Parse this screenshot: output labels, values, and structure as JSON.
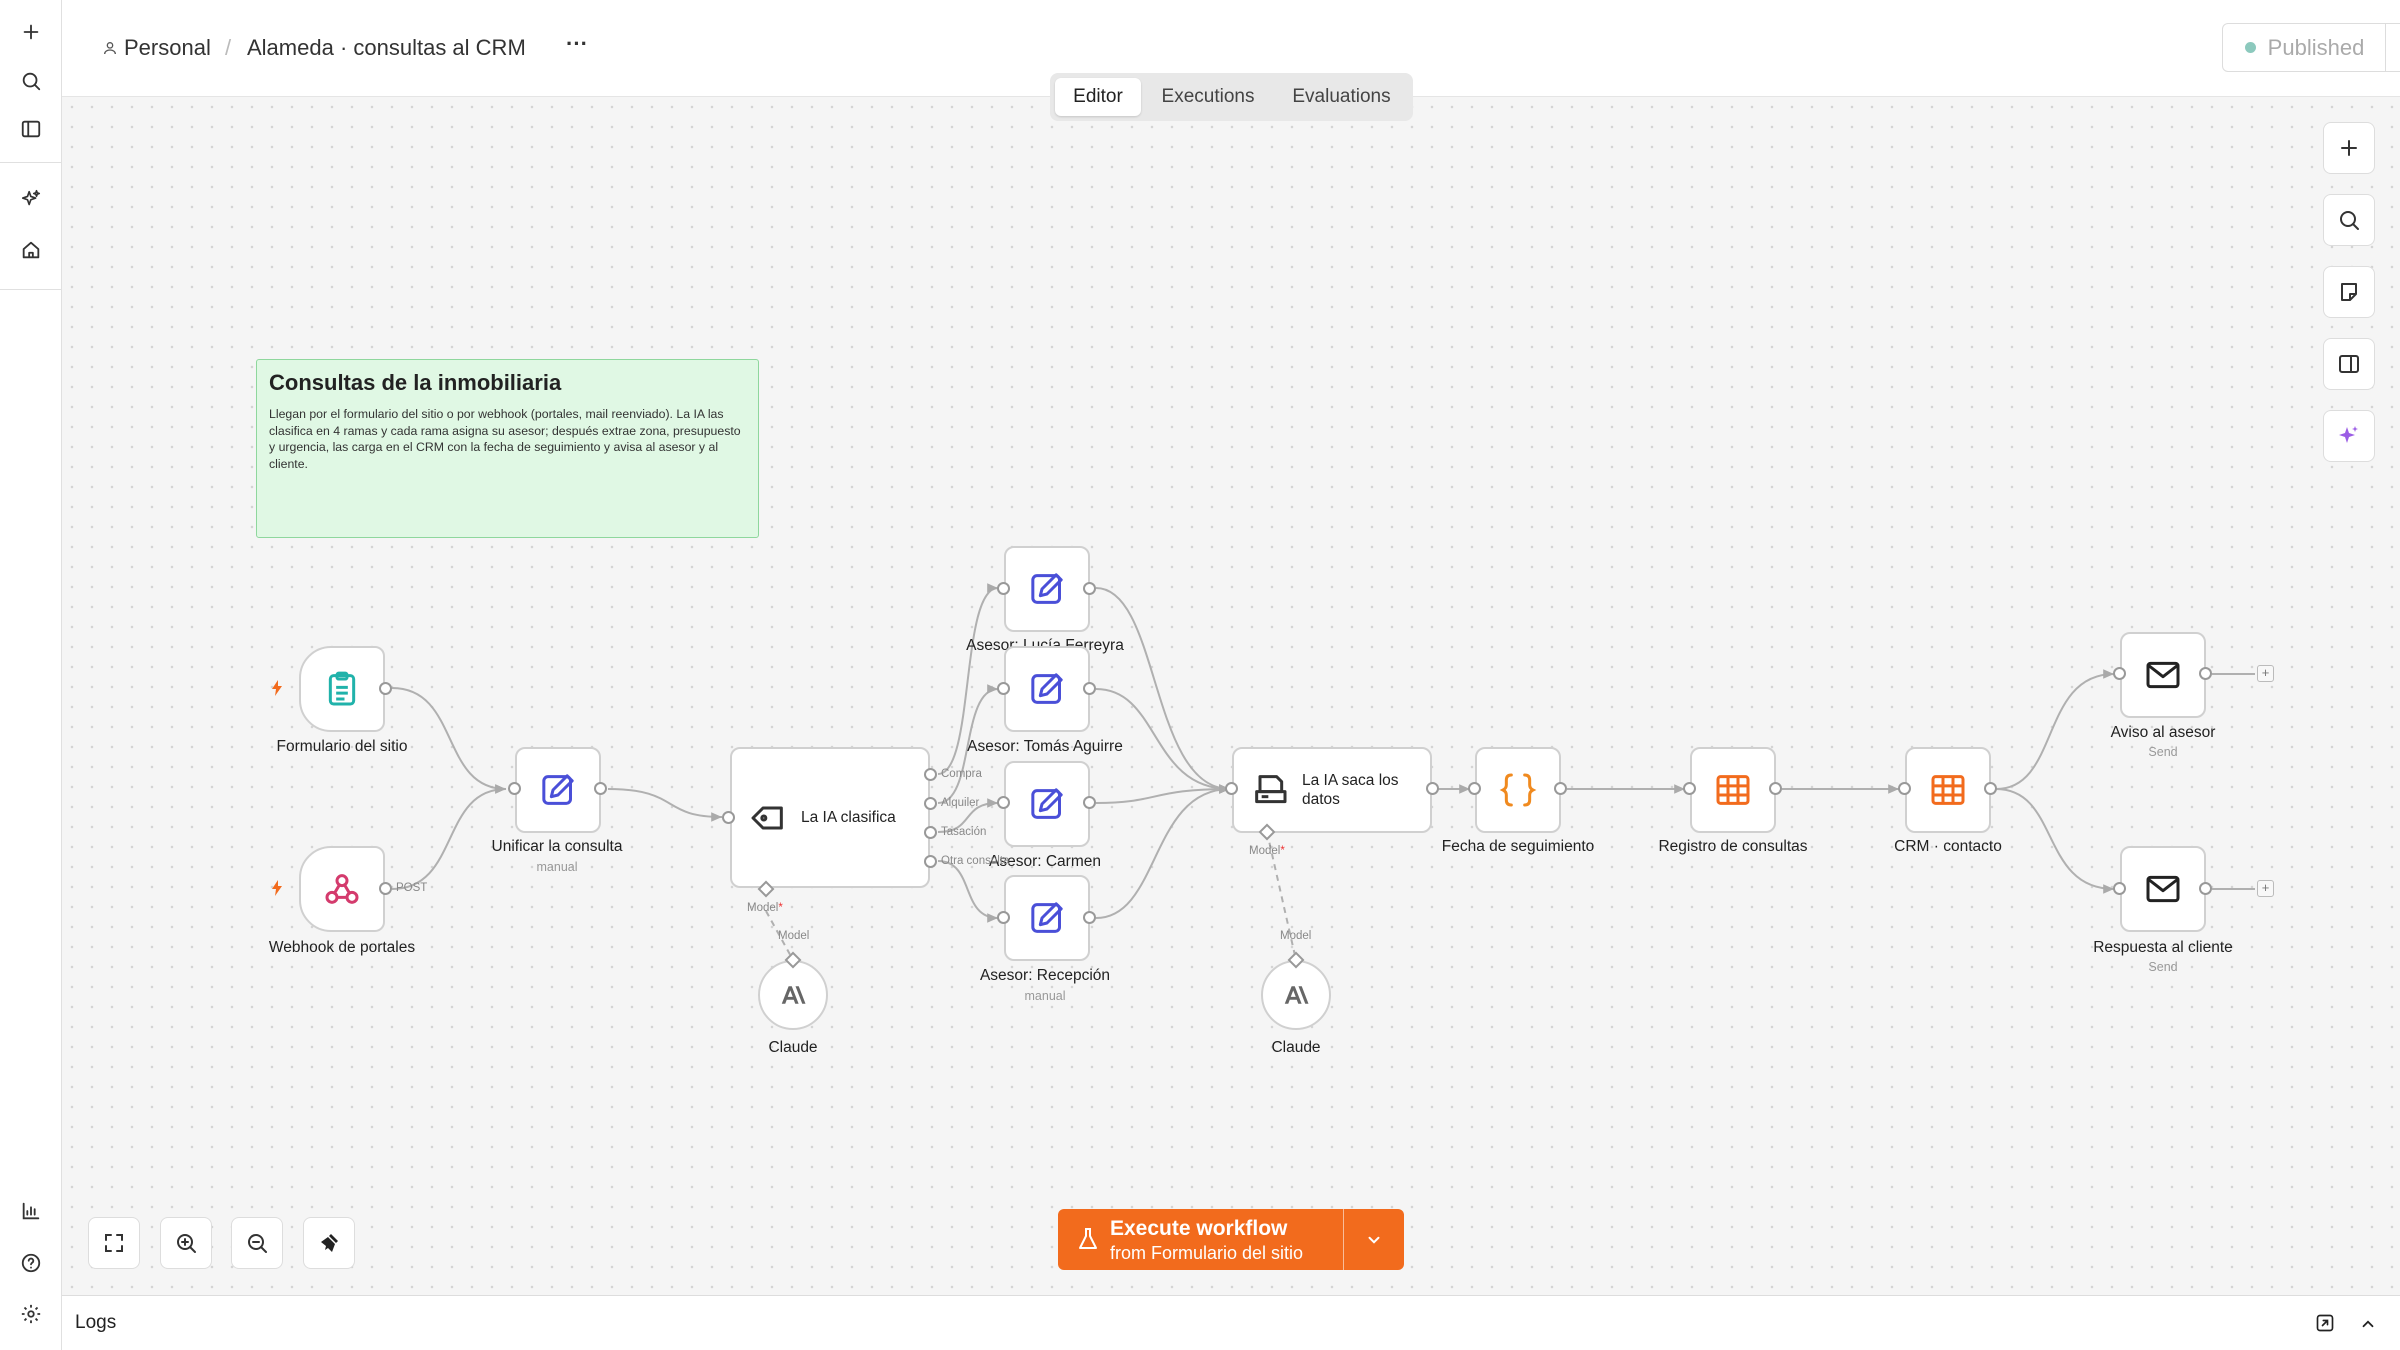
{
  "header": {
    "breadcrumb_project": "Personal",
    "breadcrumb_separator": "/",
    "workflow_name": "Alameda · consultas al CRM",
    "more_label": "···",
    "status_label": "Published",
    "status_color": "#8cc9bd"
  },
  "tabs": [
    "Editor",
    "Executions",
    "Evaluations"
  ],
  "active_tab": "Editor",
  "sticky": {
    "title": "Consultas de la inmobiliaria",
    "body": "Llegan por el formulario del sitio o por webhook (portales, mail reenviado). La IA las clasifica en 4 ramas y cada rama asigna su asesor; después extrae zona, presupuesto y urgencia, las carga en el CRM con la fecha de seguimiento y avisa al asesor y al cliente.",
    "color": "#e0f8e4"
  },
  "nodes": {
    "form": {
      "label": "Formulario del sitio",
      "icon": "clipboard-icon"
    },
    "webhook": {
      "label": "Webhook de portales",
      "icon": "webhook-icon",
      "port_label": "POST"
    },
    "unify": {
      "label": "Unificar la consulta",
      "sub": "manual",
      "icon": "pencil-icon"
    },
    "classify": {
      "label": "La IA clasifica",
      "icon": "tag-icon",
      "outputs": [
        "Compra",
        "Alquiler",
        "Tasación",
        "Otra consulta"
      ],
      "model_port": "Model"
    },
    "lucia": {
      "label": "Asesor: Lucía Ferreyra",
      "icon": "pencil-icon"
    },
    "tomas": {
      "label": "Asesor: Tomás Aguirre",
      "icon": "pencil-icon"
    },
    "carmen": {
      "label": "Asesor: Carmen",
      "icon": "pencil-icon"
    },
    "recepcion": {
      "label": "Asesor: Recepción",
      "sub": "manual",
      "icon": "pencil-icon"
    },
    "claude1": {
      "label": "Claude",
      "icon": "anthropic-icon",
      "port_label": "Model"
    },
    "extract": {
      "label": "La IA saca los datos",
      "icon": "scanner-icon",
      "model_port": "Model"
    },
    "claude2": {
      "label": "Claude",
      "icon": "anthropic-icon",
      "port_label": "Model"
    },
    "fecha": {
      "label": "Fecha de seguimiento",
      "icon": "braces-icon"
    },
    "registro": {
      "label": "Registro de consultas",
      "icon": "table-icon"
    },
    "crm": {
      "label": "CRM · contacto",
      "icon": "table-icon"
    },
    "aviso": {
      "label": "Aviso al asesor",
      "sub": "Send",
      "icon": "mail-icon"
    },
    "respuesta": {
      "label": "Respuesta al cliente",
      "sub": "Send",
      "icon": "mail-icon"
    }
  },
  "execute": {
    "title": "Execute workflow",
    "subtitle": "from Formulario del sitio",
    "color": "#f26b1d"
  },
  "logs": {
    "label": "Logs"
  },
  "colors": {
    "trigger_bolt": "#f26b1d",
    "form_icon": "#20b2aa",
    "webhook_icon": "#d43b6d",
    "edit_icon": "#4a4fd8",
    "orange_icon": "#f08a1f",
    "ai_accent": "#9b5de5"
  }
}
